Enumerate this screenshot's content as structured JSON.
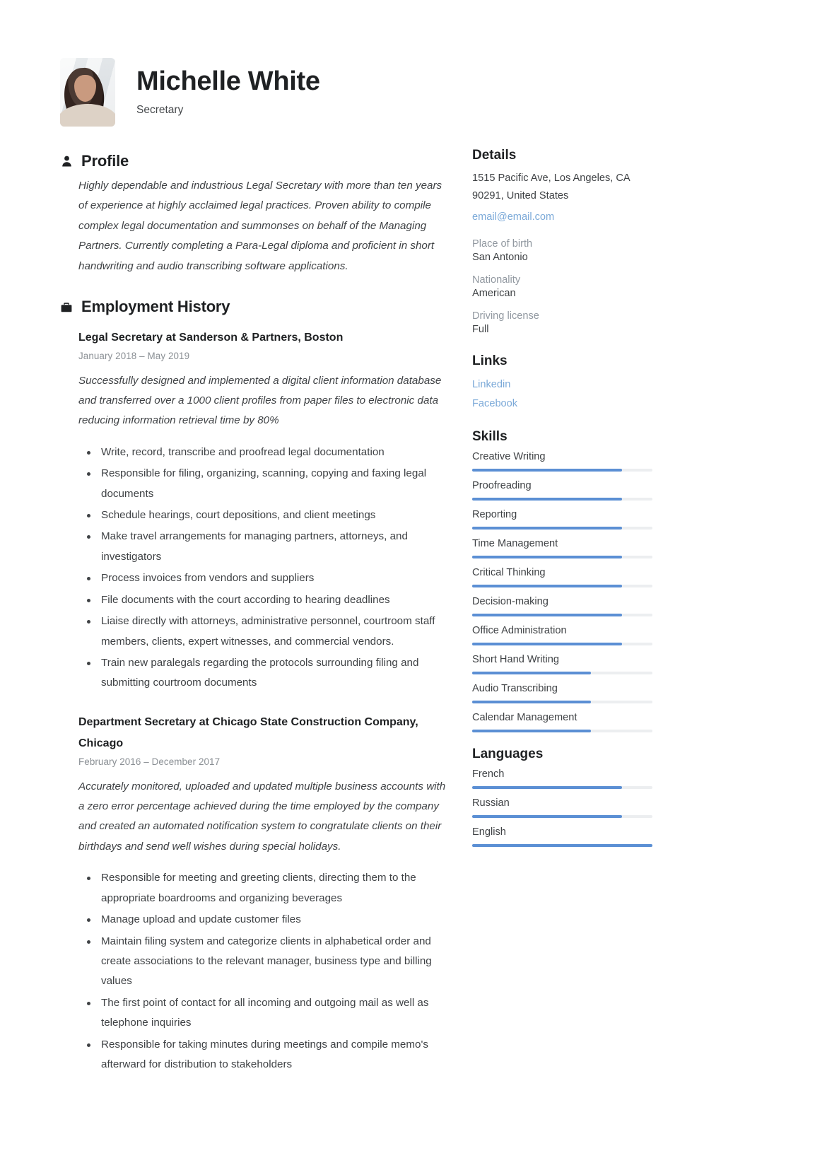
{
  "header": {
    "name": "Michelle White",
    "job_title": "Secretary",
    "avatar_alt": "profile-photo"
  },
  "profile": {
    "heading": "Profile",
    "icon": "person-icon",
    "text": "Highly dependable and industrious Legal Secretary with more than ten years of experience at highly acclaimed legal practices. Proven ability to compile complex legal documentation and summonses on behalf of the Managing Partners. Currently completing a Para-Legal diploma and proficient in short handwriting and audio transcribing software applications."
  },
  "employment": {
    "heading": "Employment History",
    "icon": "briefcase-icon",
    "jobs": [
      {
        "title": "Legal Secretary at Sanderson & Partners, Boston",
        "dates": "January 2018  –  May 2019",
        "description": "Successfully designed and implemented a digital client information database and transferred over a 1000 client profiles from paper files to electronic data reducing information retrieval time by 80%",
        "bullets": [
          "Write, record, transcribe and proofread legal documentation",
          "Responsible for filing, organizing, scanning, copying and faxing legal documents",
          "Schedule hearings, court depositions, and client meetings",
          "Make travel arrangements for managing partners, attorneys, and investigators",
          "Process invoices from vendors and suppliers",
          "File documents with the court according to hearing deadlines",
          "Liaise directly with attorneys, administrative personnel, courtroom staff members, clients, expert witnesses, and commercial vendors.",
          "Train new paralegals regarding the protocols surrounding filing and submitting courtroom documents"
        ]
      },
      {
        "title": "Department Secretary at Chicago State Construction Company, Chicago",
        "dates": "February 2016  –  December 2017",
        "description": "Accurately monitored, uploaded and updated multiple business accounts with a zero error percentage achieved during the time employed by the company and created an automated notification system to congratulate clients on their birthdays and send well wishes during special holidays.",
        "bullets": [
          "Responsible for meeting and greeting clients, directing them to the appropriate boardrooms and organizing beverages",
          "Manage upload and update customer files",
          "Maintain filing system and categorize clients in alphabetical order and create associations to the relevant manager, business type and billing values",
          "The first point of contact for all incoming and outgoing mail as well as telephone inquiries",
          "Responsible for taking minutes during meetings and compile memo's afterward for distribution to stakeholders"
        ]
      }
    ]
  },
  "details": {
    "heading": "Details",
    "address_line1": "1515 Pacific Ave, Los Angeles, CA",
    "address_line2": "90291, United States",
    "email": "email@email.com",
    "fields": [
      {
        "label": "Place of birth",
        "value": "San Antonio"
      },
      {
        "label": "Nationality",
        "value": "American"
      },
      {
        "label": "Driving license",
        "value": "Full"
      }
    ]
  },
  "links": {
    "heading": "Links",
    "items": [
      {
        "label": "Linkedin"
      },
      {
        "label": "Facebook"
      }
    ]
  },
  "skills": {
    "heading": "Skills",
    "items": [
      {
        "name": "Creative Writing",
        "level": 83
      },
      {
        "name": "Proofreading",
        "level": 83
      },
      {
        "name": "Reporting",
        "level": 83
      },
      {
        "name": "Time Management",
        "level": 83
      },
      {
        "name": "Critical Thinking",
        "level": 83
      },
      {
        "name": "Decision-making",
        "level": 83
      },
      {
        "name": "Office Administration",
        "level": 83
      },
      {
        "name": "Short Hand Writing",
        "level": 66
      },
      {
        "name": "Audio Transcribing",
        "level": 66
      },
      {
        "name": "Calendar Management",
        "level": 66
      }
    ]
  },
  "languages": {
    "heading": "Languages",
    "items": [
      {
        "name": "French",
        "level": 83
      },
      {
        "name": "Russian",
        "level": 83
      },
      {
        "name": "English",
        "level": 100
      }
    ]
  },
  "theme": {
    "accent": "#5b8fd4",
    "link": "#7ba9d8",
    "text": "#3f4245",
    "heading": "#1f2123",
    "muted": "#9198a0",
    "track": "#eceef0"
  }
}
